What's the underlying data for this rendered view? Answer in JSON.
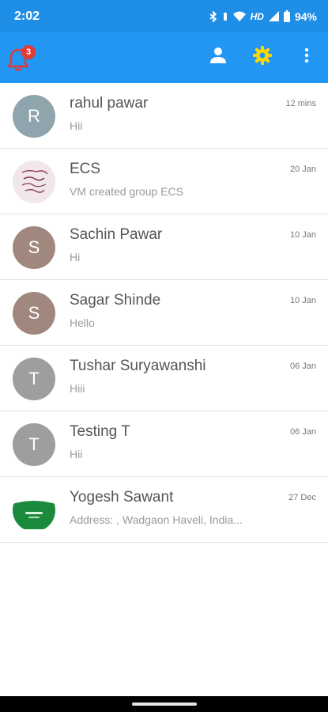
{
  "status_bar": {
    "time": "2:02",
    "network": "HD",
    "battery": "94%"
  },
  "app_bar": {
    "notification_count": "3",
    "accent_color": "#2196f3",
    "icons": [
      "bell-icon",
      "person-icon",
      "gear-icon",
      "more-vert-icon"
    ]
  },
  "chats": [
    {
      "name": "rahul pawar",
      "message": "Hii",
      "time": "12 mins",
      "avatar_letter": "R",
      "avatar_color": "#90a4ae"
    },
    {
      "name": "ECS",
      "message": "VM created group ECS",
      "time": "20 Jan",
      "avatar_letter": "",
      "avatar_color": "#f3e9ec"
    },
    {
      "name": "Sachin Pawar",
      "message": "Hi",
      "time": "10 Jan",
      "avatar_letter": "S",
      "avatar_color": "#a1887f"
    },
    {
      "name": "Sagar Shinde",
      "message": "Hello",
      "time": "10 Jan",
      "avatar_letter": "S",
      "avatar_color": "#a1887f"
    },
    {
      "name": "Tushar Suryawanshi",
      "message": "Hiii",
      "time": "06 Jan",
      "avatar_letter": "T",
      "avatar_color": "#9e9e9e"
    },
    {
      "name": "Testing T",
      "message": "Hii",
      "time": "06 Jan",
      "avatar_letter": "T",
      "avatar_color": "#9e9e9e"
    },
    {
      "name": "Yogesh Sawant",
      "message": "Address: , Wadgaon Haveli, India...",
      "time": "27 Dec",
      "avatar_letter": "",
      "avatar_color": "#1b8a3c"
    }
  ]
}
